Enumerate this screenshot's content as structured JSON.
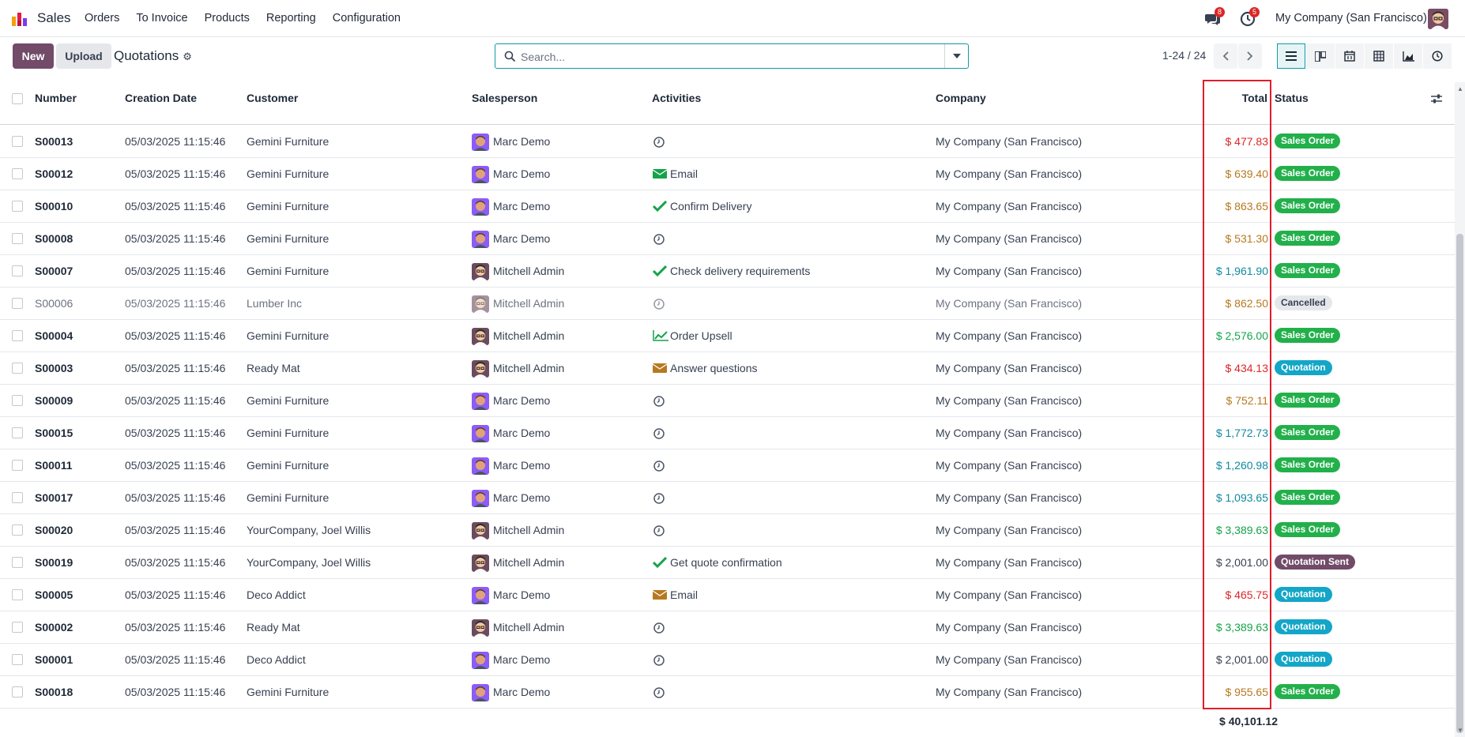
{
  "app": {
    "name": "Sales"
  },
  "menu": [
    "Orders",
    "To Invoice",
    "Products",
    "Reporting",
    "Configuration"
  ],
  "notifications": {
    "messages_count": "8",
    "activities_count": "5"
  },
  "company_switcher": "My Company (San Francisco)",
  "control": {
    "new_label": "New",
    "upload_label": "Upload",
    "breadcrumb": "Quotations",
    "search_placeholder": "Search...",
    "pager": "1-24 / 24"
  },
  "columns": {
    "number": "Number",
    "creation_date": "Creation Date",
    "customer": "Customer",
    "salesperson": "Salesperson",
    "activities": "Activities",
    "company": "Company",
    "total": "Total",
    "status": "Status"
  },
  "colors": {
    "brand": "#714b67",
    "accent": "#0e9aa7",
    "total_red": "#dc2626",
    "total_amber": "#b7791f",
    "total_teal": "#0e8aa0",
    "total_green": "#15a34a",
    "total_dark": "#374151",
    "status_sales_order": "#22b04b",
    "status_quotation": "#13a6c7",
    "status_quotation_sent": "#714b67",
    "status_cancelled": "#e5e7eb",
    "highlight": "#e11d2a"
  },
  "rows": [
    {
      "number": "S00013",
      "date": "05/03/2025 11:15:46",
      "customer": "Gemini Furniture",
      "salesperson": "Marc Demo",
      "avatar": "marc",
      "activity_icon": "clock-icon",
      "activity": "",
      "company": "My Company (San Francisco)",
      "total": "$ 477.83",
      "total_color": "red",
      "status": "Sales Order",
      "status_kind": "sales_order"
    },
    {
      "number": "S00012",
      "date": "05/03/2025 11:15:46",
      "customer": "Gemini Furniture",
      "salesperson": "Marc Demo",
      "avatar": "marc",
      "activity_icon": "envelope-green-icon",
      "activity": "Email",
      "company": "My Company (San Francisco)",
      "total": "$ 639.40",
      "total_color": "amber",
      "status": "Sales Order",
      "status_kind": "sales_order"
    },
    {
      "number": "S00010",
      "date": "05/03/2025 11:15:46",
      "customer": "Gemini Furniture",
      "salesperson": "Marc Demo",
      "avatar": "marc",
      "activity_icon": "check-icon",
      "activity": "Confirm Delivery",
      "company": "My Company (San Francisco)",
      "total": "$ 863.65",
      "total_color": "amber",
      "status": "Sales Order",
      "status_kind": "sales_order"
    },
    {
      "number": "S00008",
      "date": "05/03/2025 11:15:46",
      "customer": "Gemini Furniture",
      "salesperson": "Marc Demo",
      "avatar": "marc",
      "activity_icon": "clock-icon",
      "activity": "",
      "company": "My Company (San Francisco)",
      "total": "$ 531.30",
      "total_color": "amber",
      "status": "Sales Order",
      "status_kind": "sales_order"
    },
    {
      "number": "S00007",
      "date": "05/03/2025 11:15:46",
      "customer": "Gemini Furniture",
      "salesperson": "Mitchell Admin",
      "avatar": "mitchell",
      "activity_icon": "check-icon",
      "activity": "Check delivery requirements",
      "company": "My Company (San Francisco)",
      "total": "$ 1,961.90",
      "total_color": "teal",
      "status": "Sales Order",
      "status_kind": "sales_order"
    },
    {
      "number": "S00006",
      "date": "05/03/2025 11:15:46",
      "customer": "Lumber Inc",
      "salesperson": "Mitchell Admin",
      "avatar": "mitchell",
      "activity_icon": "clock-icon",
      "activity": "",
      "company": "My Company (San Francisco)",
      "total": "$ 862.50",
      "total_color": "amber",
      "status": "Cancelled",
      "status_kind": "cancelled",
      "dim": true
    },
    {
      "number": "S00004",
      "date": "05/03/2025 11:15:46",
      "customer": "Gemini Furniture",
      "salesperson": "Mitchell Admin",
      "avatar": "mitchell",
      "activity_icon": "chart-up-icon",
      "activity": "Order Upsell",
      "company": "My Company (San Francisco)",
      "total": "$ 2,576.00",
      "total_color": "green",
      "status": "Sales Order",
      "status_kind": "sales_order"
    },
    {
      "number": "S00003",
      "date": "05/03/2025 11:15:46",
      "customer": "Ready Mat",
      "salesperson": "Mitchell Admin",
      "avatar": "mitchell",
      "activity_icon": "envelope-amber-icon",
      "activity": "Answer questions",
      "company": "My Company (San Francisco)",
      "total": "$ 434.13",
      "total_color": "red",
      "status": "Quotation",
      "status_kind": "quotation"
    },
    {
      "number": "S00009",
      "date": "05/03/2025 11:15:46",
      "customer": "Gemini Furniture",
      "salesperson": "Marc Demo",
      "avatar": "marc",
      "activity_icon": "clock-icon",
      "activity": "",
      "company": "My Company (San Francisco)",
      "total": "$ 752.11",
      "total_color": "amber",
      "status": "Sales Order",
      "status_kind": "sales_order"
    },
    {
      "number": "S00015",
      "date": "05/03/2025 11:15:46",
      "customer": "Gemini Furniture",
      "salesperson": "Marc Demo",
      "avatar": "marc",
      "activity_icon": "clock-icon",
      "activity": "",
      "company": "My Company (San Francisco)",
      "total": "$ 1,772.73",
      "total_color": "teal",
      "status": "Sales Order",
      "status_kind": "sales_order"
    },
    {
      "number": "S00011",
      "date": "05/03/2025 11:15:46",
      "customer": "Gemini Furniture",
      "salesperson": "Marc Demo",
      "avatar": "marc",
      "activity_icon": "clock-icon",
      "activity": "",
      "company": "My Company (San Francisco)",
      "total": "$ 1,260.98",
      "total_color": "teal",
      "status": "Sales Order",
      "status_kind": "sales_order"
    },
    {
      "number": "S00017",
      "date": "05/03/2025 11:15:46",
      "customer": "Gemini Furniture",
      "salesperson": "Marc Demo",
      "avatar": "marc",
      "activity_icon": "clock-icon",
      "activity": "",
      "company": "My Company (San Francisco)",
      "total": "$ 1,093.65",
      "total_color": "teal",
      "status": "Sales Order",
      "status_kind": "sales_order"
    },
    {
      "number": "S00020",
      "date": "05/03/2025 11:15:46",
      "customer": "YourCompany, Joel Willis",
      "salesperson": "Mitchell Admin",
      "avatar": "mitchell",
      "activity_icon": "clock-icon",
      "activity": "",
      "company": "My Company (San Francisco)",
      "total": "$ 3,389.63",
      "total_color": "green",
      "status": "Sales Order",
      "status_kind": "sales_order"
    },
    {
      "number": "S00019",
      "date": "05/03/2025 11:15:46",
      "customer": "YourCompany, Joel Willis",
      "salesperson": "Mitchell Admin",
      "avatar": "mitchell",
      "activity_icon": "check-icon",
      "activity": "Get quote confirmation",
      "company": "My Company (San Francisco)",
      "total": "$ 2,001.00",
      "total_color": "dark",
      "status": "Quotation Sent",
      "status_kind": "quotation_sent"
    },
    {
      "number": "S00005",
      "date": "05/03/2025 11:15:46",
      "customer": "Deco Addict",
      "salesperson": "Marc Demo",
      "avatar": "marc",
      "activity_icon": "envelope-amber-icon",
      "activity": "Email",
      "company": "My Company (San Francisco)",
      "total": "$ 465.75",
      "total_color": "red",
      "status": "Quotation",
      "status_kind": "quotation"
    },
    {
      "number": "S00002",
      "date": "05/03/2025 11:15:46",
      "customer": "Ready Mat",
      "salesperson": "Mitchell Admin",
      "avatar": "mitchell",
      "activity_icon": "clock-icon",
      "activity": "",
      "company": "My Company (San Francisco)",
      "total": "$ 3,389.63",
      "total_color": "green",
      "status": "Quotation",
      "status_kind": "quotation"
    },
    {
      "number": "S00001",
      "date": "05/03/2025 11:15:46",
      "customer": "Deco Addict",
      "salesperson": "Marc Demo",
      "avatar": "marc",
      "activity_icon": "clock-icon",
      "activity": "",
      "company": "My Company (San Francisco)",
      "total": "$ 2,001.00",
      "total_color": "dark",
      "status": "Quotation",
      "status_kind": "quotation"
    },
    {
      "number": "S00018",
      "date": "05/03/2025 11:15:46",
      "customer": "Gemini Furniture",
      "salesperson": "Marc Demo",
      "avatar": "marc",
      "activity_icon": "clock-icon",
      "activity": "",
      "company": "My Company (San Francisco)",
      "total": "$ 955.65",
      "total_color": "amber",
      "status": "Sales Order",
      "status_kind": "sales_order"
    }
  ],
  "grand_total": "$ 40,101.12"
}
